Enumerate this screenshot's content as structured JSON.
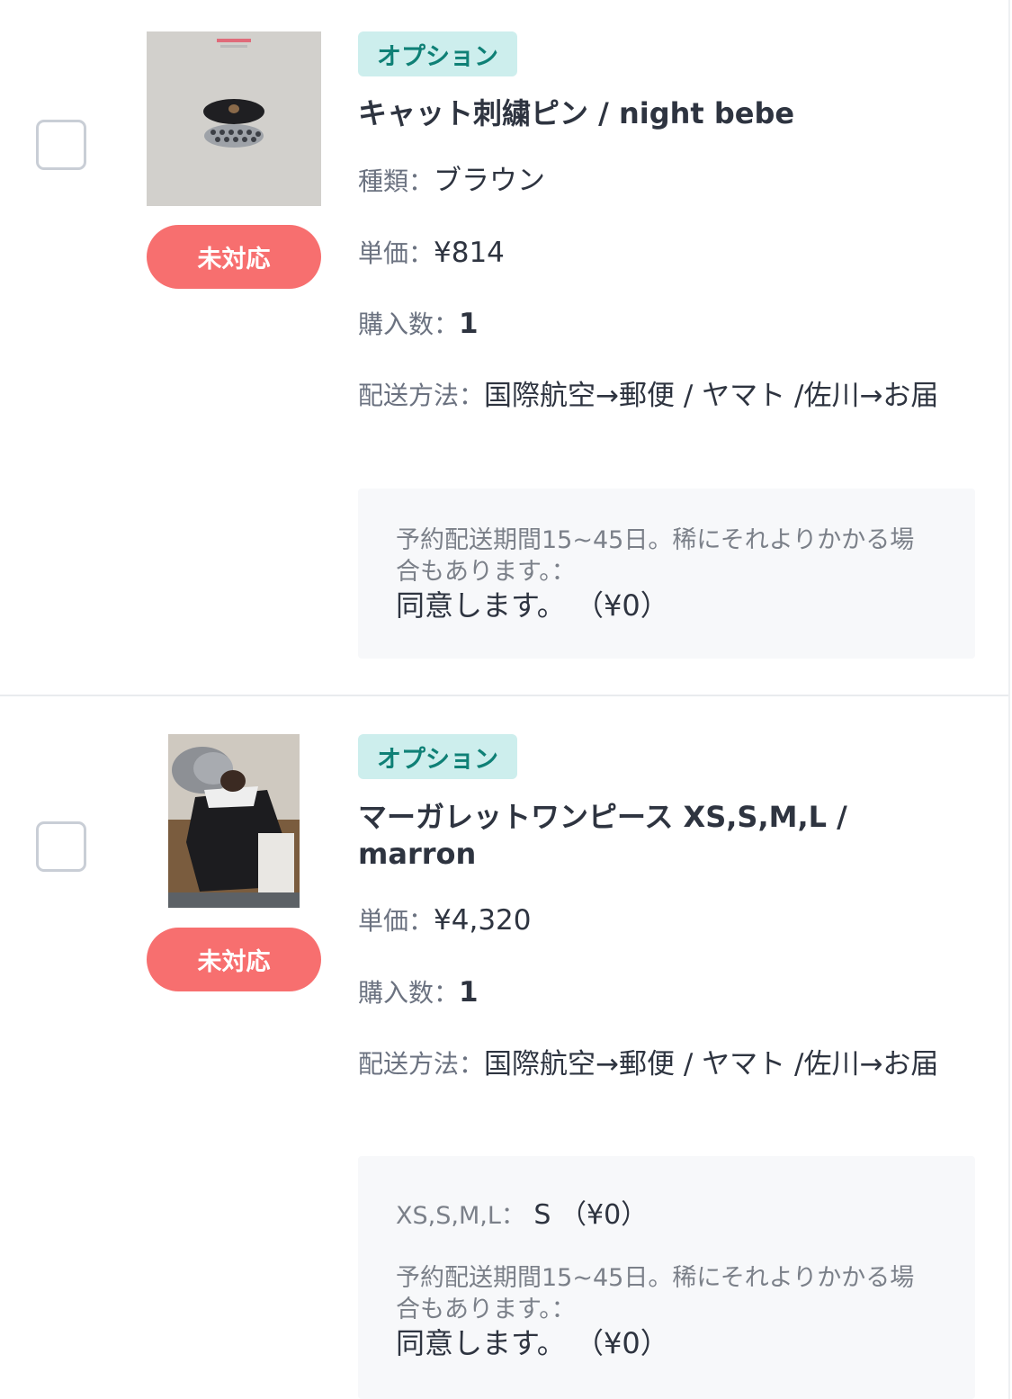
{
  "items": [
    {
      "tag": "オプション",
      "title": "キャット刺繍ピン / night bebe",
      "status": "未対応",
      "kind_label": "種類：",
      "kind_value": "ブラウン",
      "price_label": "単価：",
      "price_value": "¥814",
      "qty_label": "購入数：",
      "qty_value": "1",
      "shipping_label": "配送方法：",
      "shipping_value": "国際航空→郵便 / ヤマト /佐川→お届",
      "note_question": "予約配送期間15~45日。稀にそれよりかかる場合もあります。：",
      "note_answer": "同意します。 （¥0）"
    },
    {
      "tag": "オプション",
      "title": "マーガレットワンピース XS,S,M,L / marron",
      "status": "未対応",
      "price_label": "単価：",
      "price_value": "¥4,320",
      "qty_label": "購入数：",
      "qty_value": "1",
      "shipping_label": "配送方法：",
      "shipping_value": "国際航空→郵便 / ヤマト /佐川→お届",
      "size_label": "XS,S,M,L：",
      "size_value": "S （¥0）",
      "note_question": "予約配送期間15~45日。稀にそれよりかかる場合もあります。：",
      "note_answer": "同意します。 （¥0）"
    }
  ]
}
